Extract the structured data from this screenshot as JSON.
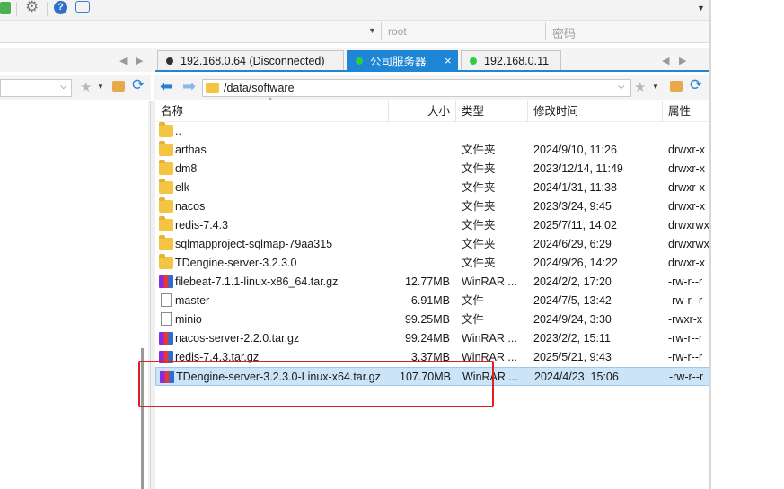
{
  "toolbar": {
    "host_placeholder": "",
    "user_value": "root",
    "password_placeholder": "密码"
  },
  "tabs": [
    {
      "label": "192.168.0.64 (Disconnected)",
      "status_color": "#333333"
    },
    {
      "label": "公司服务器",
      "status_color": "#2ecc40",
      "close": "×"
    },
    {
      "label": "192.168.0.11",
      "status_color": "#2ecc40"
    }
  ],
  "path": {
    "current": "/data/software"
  },
  "columns": {
    "name": "名称",
    "size": "大小",
    "type": "类型",
    "mtime": "修改时间",
    "attr": "属性"
  },
  "files": [
    {
      "name": "..",
      "size": "",
      "type": "",
      "mtime": "",
      "attr": "",
      "icon": "folder-icon"
    },
    {
      "name": "arthas",
      "size": "",
      "type": "文件夹",
      "mtime": "2024/9/10, 11:26",
      "attr": "drwxr-x",
      "icon": "folder-icon"
    },
    {
      "name": "dm8",
      "size": "",
      "type": "文件夹",
      "mtime": "2023/12/14, 11:49",
      "attr": "drwxr-x",
      "icon": "folder-icon"
    },
    {
      "name": "elk",
      "size": "",
      "type": "文件夹",
      "mtime": "2024/1/31, 11:38",
      "attr": "drwxr-x",
      "icon": "folder-icon"
    },
    {
      "name": "nacos",
      "size": "",
      "type": "文件夹",
      "mtime": "2023/3/24, 9:45",
      "attr": "drwxr-x",
      "icon": "folder-icon"
    },
    {
      "name": "redis-7.4.3",
      "size": "",
      "type": "文件夹",
      "mtime": "2025/7/11, 14:02",
      "attr": "drwxrwx",
      "icon": "folder-icon"
    },
    {
      "name": "sqlmapproject-sqlmap-79aa315",
      "size": "",
      "type": "文件夹",
      "mtime": "2024/6/29, 6:29",
      "attr": "drwxrwx",
      "icon": "folder-icon"
    },
    {
      "name": "TDengine-server-3.2.3.0",
      "size": "",
      "type": "文件夹",
      "mtime": "2024/9/26, 14:22",
      "attr": "drwxr-x",
      "icon": "folder-icon"
    },
    {
      "name": "filebeat-7.1.1-linux-x86_64.tar.gz",
      "size": "12.77MB",
      "type": "WinRAR ...",
      "mtime": "2024/2/2, 17:20",
      "attr": "-rw-r--r",
      "icon": "archive-icon"
    },
    {
      "name": "master",
      "size": "6.91MB",
      "type": "文件",
      "mtime": "2024/7/5, 13:42",
      "attr": "-rw-r--r",
      "icon": "file-icon"
    },
    {
      "name": "minio",
      "size": "99.25MB",
      "type": "文件",
      "mtime": "2024/9/24, 3:30",
      "attr": "-rwxr-x",
      "icon": "file-icon"
    },
    {
      "name": "nacos-server-2.2.0.tar.gz",
      "size": "99.24MB",
      "type": "WinRAR ...",
      "mtime": "2023/2/2, 15:11",
      "attr": "-rw-r--r",
      "icon": "archive-icon"
    },
    {
      "name": "redis-7.4.3.tar.gz",
      "size": "3.37MB",
      "type": "WinRAR ...",
      "mtime": "2025/5/21, 9:43",
      "attr": "-rw-r--r",
      "icon": "archive-icon"
    },
    {
      "name": "TDengine-server-3.2.3.0-Linux-x64.tar.gz",
      "size": "107.70MB",
      "type": "WinRAR ...",
      "mtime": "2024/4/23, 15:06",
      "attr": "-rw-r--r",
      "icon": "archive-icon",
      "selected": true
    }
  ],
  "colors": {
    "accent": "#1f86d6",
    "highlight_box": "#e02020",
    "selection": "#cce4f7"
  }
}
